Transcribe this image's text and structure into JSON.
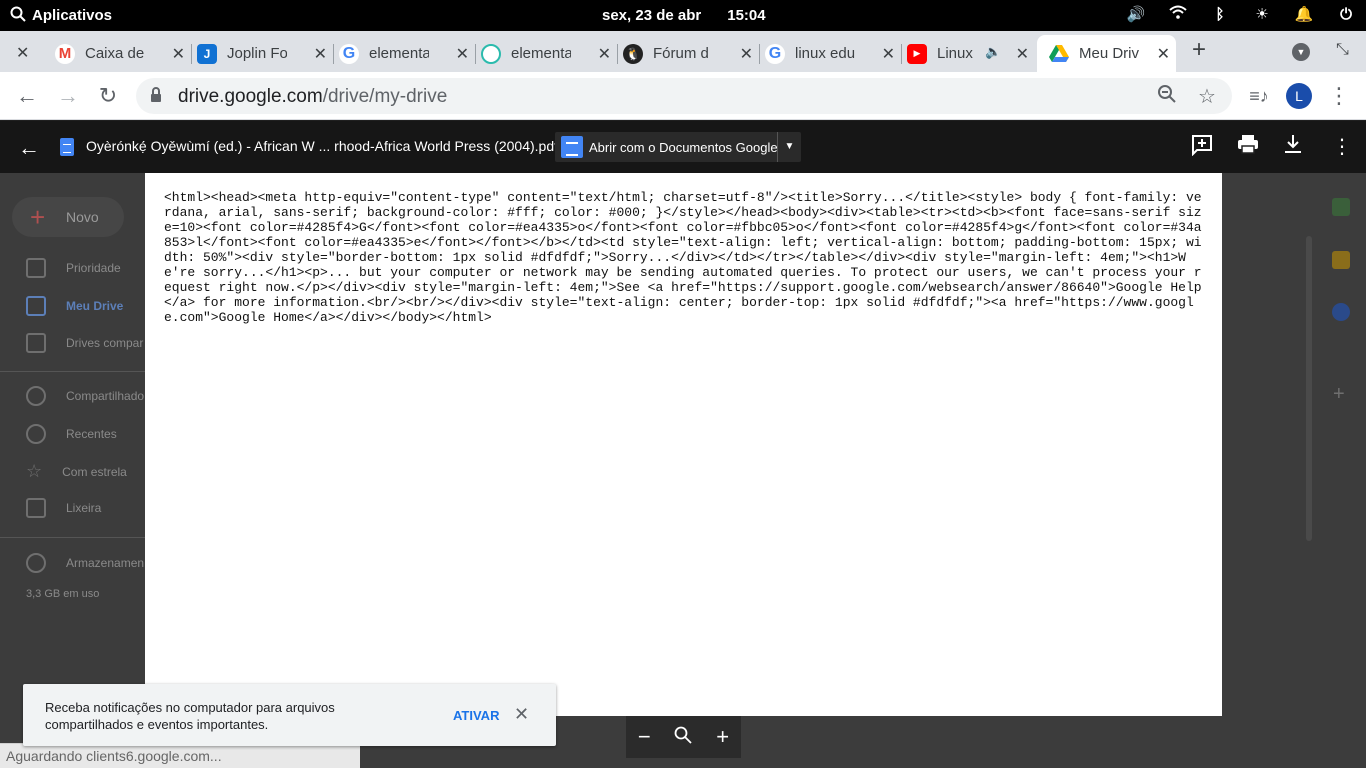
{
  "topbar": {
    "apps_label": "Aplicativos",
    "date": "sex, 23 de abr",
    "time": "15:04"
  },
  "tabs": [
    {
      "title": "Caixa de",
      "favicon": "gmail-icon"
    },
    {
      "title": "Joplin Fo",
      "favicon": "joplin-icon"
    },
    {
      "title": "elementa",
      "favicon": "google-icon"
    },
    {
      "title": "elementa",
      "favicon": "elementary-icon"
    },
    {
      "title": "Fórum d",
      "favicon": "tux-icon"
    },
    {
      "title": "linux edu",
      "favicon": "google-icon"
    },
    {
      "title": "Linux",
      "favicon": "youtube-icon"
    },
    {
      "title": "Meu Driv",
      "favicon": "drive-icon"
    }
  ],
  "address": {
    "domain": "drive.google.com",
    "path": "/drive/my-drive"
  },
  "profile_initial": "L",
  "viewer": {
    "filename": "Oyèrónkẹ́ Oyěwùmí (ed.) - African W ... rhood-Africa World Press (2004).pdf",
    "open_with_label": "Abrir com o Documentos Google"
  },
  "document_text": "<html><head><meta http-equiv=\"content-type\" content=\"text/html; charset=utf-8\"/><title>Sorry...</title><style> body { font-family: verdana, arial, sans-serif; background-color: #fff; color: #000; }</style></head><body><div><table><tr><td><b><font face=sans-serif size=10><font color=#4285f4>G</font><font color=#ea4335>o</font><font color=#fbbc05>o</font><font color=#4285f4>g</font><font color=#34a853>l</font><font color=#ea4335>e</font></font></b></td><td style=\"text-align: left; vertical-align: bottom; padding-bottom: 15px; width: 50%\"><div style=\"border-bottom: 1px solid #dfdfdf;\">Sorry...</div></td></tr></table></div><div style=\"margin-left: 4em;\"><h1>We're sorry...</h1><p>... but your computer or network may be sending automated queries. To protect our users, we can't process your request right now.</p></div><div style=\"margin-left: 4em;\">See <a href=\"https://support.google.com/websearch/answer/86640\">Google Help</a> for more information.<br/><br/></div><div style=\"text-align: center; border-top: 1px solid #dfdfdf;\"><a href=\"https://www.google.com\">Google Home</a></div></body></html>",
  "drive_sidebar": {
    "new_label": "Novo",
    "items": [
      "Prioridade",
      "Meu Drive",
      "Drives compar",
      "Compartilhado",
      "Recentes",
      "Com estrela",
      "Lixeira",
      "Armazenamen"
    ],
    "storage_used": "3,3 GB em uso"
  },
  "toast": {
    "message": "Receba notificações no computador para arquivos compartilhados e eventos importantes.",
    "action": "ATIVAR"
  },
  "status_text": "Aguardando clients6.google.com...",
  "colors": {
    "accent": "#1a73e8",
    "docs_blue": "#4285f4",
    "profile": "#1a4dab"
  }
}
